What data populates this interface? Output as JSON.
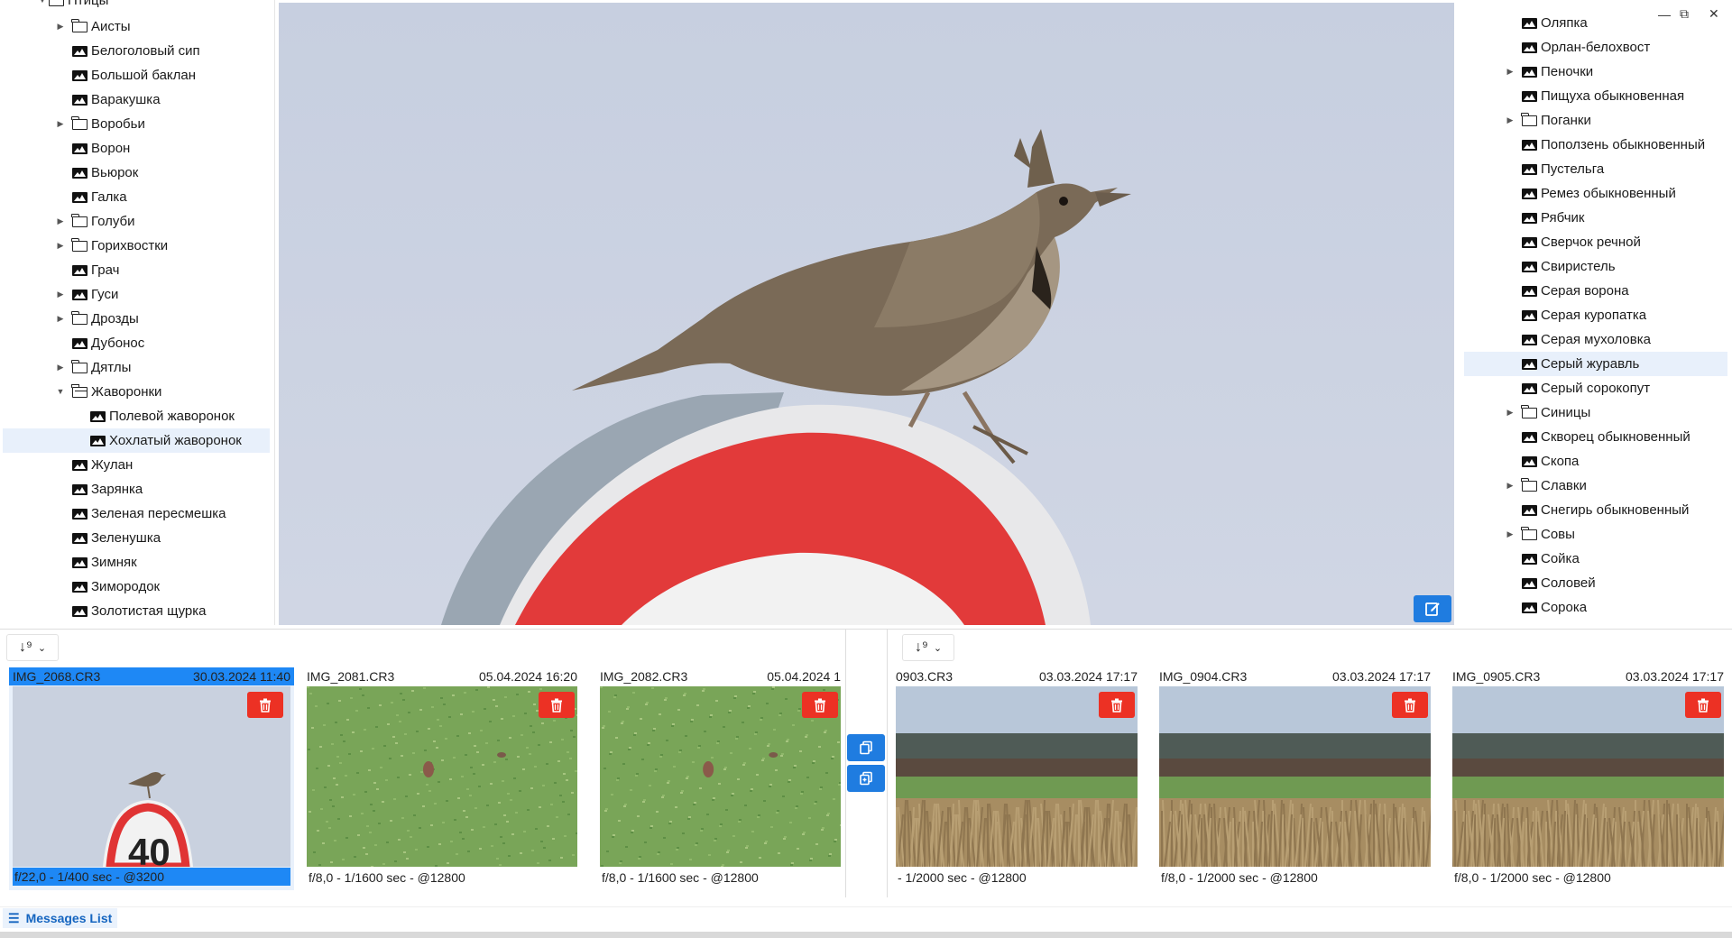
{
  "left_tree": {
    "root_label": "Птицы",
    "items": [
      {
        "label": "Аисты",
        "type": "folder",
        "expandable": true,
        "level": 1
      },
      {
        "label": "Белоголовый сип",
        "type": "image",
        "expandable": false,
        "level": 1
      },
      {
        "label": "Большой баклан",
        "type": "image",
        "expandable": false,
        "level": 1
      },
      {
        "label": "Варакушка",
        "type": "image",
        "expandable": false,
        "level": 1
      },
      {
        "label": "Воробьи",
        "type": "folder",
        "expandable": true,
        "level": 1
      },
      {
        "label": "Ворон",
        "type": "image",
        "expandable": false,
        "level": 1
      },
      {
        "label": "Вьюрок",
        "type": "image",
        "expandable": false,
        "level": 1
      },
      {
        "label": "Галка",
        "type": "image",
        "expandable": false,
        "level": 1
      },
      {
        "label": "Голуби",
        "type": "folder",
        "expandable": true,
        "level": 1
      },
      {
        "label": "Горихвостки",
        "type": "folder",
        "expandable": true,
        "level": 1
      },
      {
        "label": "Грач",
        "type": "image",
        "expandable": false,
        "level": 1
      },
      {
        "label": "Гуси",
        "type": "image",
        "expandable": true,
        "level": 1
      },
      {
        "label": "Дрозды",
        "type": "folder",
        "expandable": true,
        "level": 1
      },
      {
        "label": "Дубонос",
        "type": "image",
        "expandable": false,
        "level": 1
      },
      {
        "label": "Дятлы",
        "type": "folder",
        "expandable": true,
        "level": 1
      },
      {
        "label": "Жаворонки",
        "type": "open",
        "expandable": true,
        "expanded": true,
        "level": 1
      },
      {
        "label": "Полевой жаворонок",
        "type": "image",
        "expandable": false,
        "level": 2
      },
      {
        "label": "Хохлатый жаворонок",
        "type": "image",
        "expandable": false,
        "level": 2,
        "selected": true
      },
      {
        "label": "Жулан",
        "type": "image",
        "expandable": false,
        "level": 1
      },
      {
        "label": "Зарянка",
        "type": "image",
        "expandable": false,
        "level": 1
      },
      {
        "label": "Зеленая пересмешка",
        "type": "image",
        "expandable": false,
        "level": 1
      },
      {
        "label": "Зеленушка",
        "type": "image",
        "expandable": false,
        "level": 1
      },
      {
        "label": "Зимняк",
        "type": "image",
        "expandable": false,
        "level": 1
      },
      {
        "label": "Зимородок",
        "type": "image",
        "expandable": false,
        "level": 1
      },
      {
        "label": "Золотистая щурка",
        "type": "image",
        "expandable": false,
        "level": 1
      }
    ]
  },
  "right_tree": {
    "items": [
      {
        "label": "Оляпка",
        "type": "image",
        "expandable": false
      },
      {
        "label": "Орлан-белохвост",
        "type": "image",
        "expandable": false
      },
      {
        "label": "Пеночки",
        "type": "image",
        "expandable": true
      },
      {
        "label": "Пищуха обыкновенная",
        "type": "image",
        "expandable": false
      },
      {
        "label": "Поганки",
        "type": "folder",
        "expandable": true
      },
      {
        "label": "Поползень обыкновенный",
        "type": "image",
        "expandable": false
      },
      {
        "label": "Пустельга",
        "type": "image",
        "expandable": false
      },
      {
        "label": "Ремез обыкновенный",
        "type": "image",
        "expandable": false
      },
      {
        "label": "Рябчик",
        "type": "image",
        "expandable": false
      },
      {
        "label": "Сверчок речной",
        "type": "image",
        "expandable": false
      },
      {
        "label": "Свиристель",
        "type": "image",
        "expandable": false
      },
      {
        "label": "Серая ворона",
        "type": "image",
        "expandable": false
      },
      {
        "label": "Серая куропатка",
        "type": "image",
        "expandable": false
      },
      {
        "label": "Серая мухоловка",
        "type": "image",
        "expandable": false
      },
      {
        "label": "Серый журавль",
        "type": "image",
        "expandable": false,
        "selected": true
      },
      {
        "label": "Серый сорокопут",
        "type": "image",
        "expandable": false
      },
      {
        "label": "Синицы",
        "type": "folder",
        "expandable": true
      },
      {
        "label": "Скворец обыкновенный",
        "type": "image",
        "expandable": false
      },
      {
        "label": "Скопа",
        "type": "image",
        "expandable": false
      },
      {
        "label": "Славки",
        "type": "folder",
        "expandable": true
      },
      {
        "label": "Снегирь обыкновенный",
        "type": "image",
        "expandable": false
      },
      {
        "label": "Совы",
        "type": "folder",
        "expandable": true
      },
      {
        "label": "Сойка",
        "type": "image",
        "expandable": false
      },
      {
        "label": "Соловей",
        "type": "image",
        "expandable": false
      },
      {
        "label": "Сорока",
        "type": "image",
        "expandable": false
      }
    ]
  },
  "window_controls": {
    "minimize": "—",
    "restore": "⧉",
    "close": "✕"
  },
  "main_view": {
    "edit_icon": "edit-icon"
  },
  "left_strip": {
    "sort_icon": "sort-icon",
    "thumbs": [
      {
        "name": "IMG_2068.CR3",
        "date": "30.03.2024 11:40",
        "exif": "f/22,0 - 1/400 sec - @3200",
        "active": true,
        "scene": "sign"
      },
      {
        "name": "IMG_2081.CR3",
        "date": "05.04.2024 16:20",
        "exif": "f/8,0 - 1/1600 sec - @12800",
        "active": false,
        "scene": "grass"
      },
      {
        "name": "IMG_2082.CR3",
        "date": "05.04.2024 1",
        "exif": "f/8,0 - 1/1600 sec - @12800",
        "active": false,
        "scene": "grass"
      }
    ]
  },
  "right_strip": {
    "sort_icon": "sort-icon",
    "thumbs": [
      {
        "name": "0903.CR3",
        "date": "03.03.2024 17:17",
        "exif": "- 1/2000 sec - @12800",
        "active": false,
        "scene": "field"
      },
      {
        "name": "IMG_0904.CR3",
        "date": "03.03.2024 17:17",
        "exif": "f/8,0 - 1/2000 sec - @12800",
        "active": false,
        "scene": "field"
      },
      {
        "name": "IMG_0905.CR3",
        "date": "03.03.2024 17:17",
        "exif": "f/8,0 - 1/2000 sec - @12800",
        "active": false,
        "scene": "field"
      }
    ]
  },
  "middle_buttons": {
    "copy_icon": "copy-icon",
    "duplicate_icon": "duplicate-icon"
  },
  "messages": {
    "label": "Messages List"
  },
  "colors": {
    "accent": "#1f7ce0",
    "selection": "#1e88f5",
    "danger": "#ec3124",
    "tree_selected": "#e8f0fb"
  }
}
